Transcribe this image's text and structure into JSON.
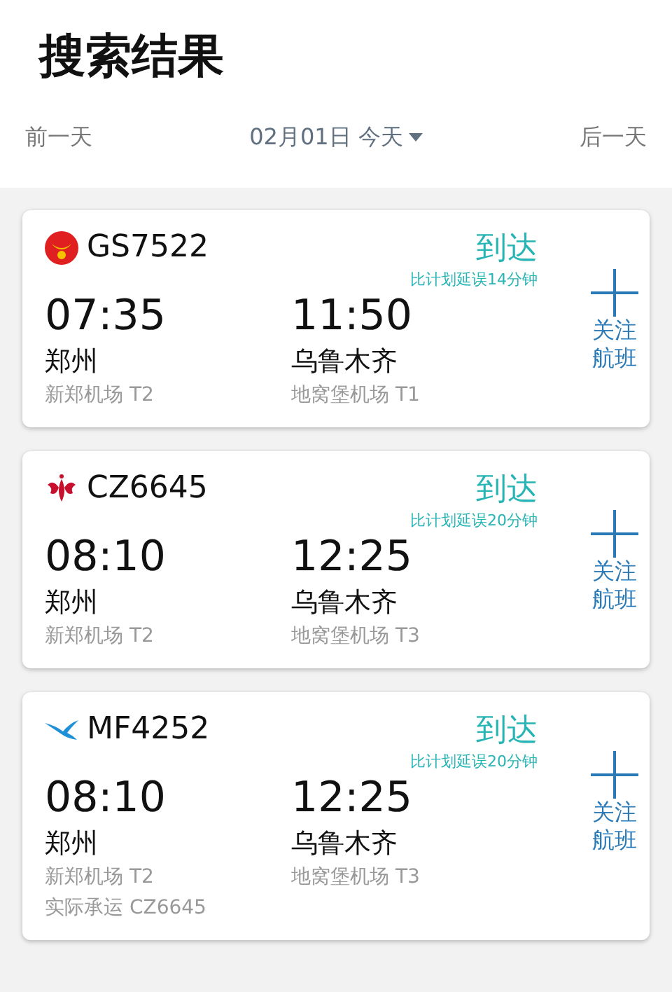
{
  "title": "搜索结果",
  "date_bar": {
    "prev": "前一天",
    "date": "02月01日 今天",
    "next": "后一天"
  },
  "flights": [
    {
      "kind": "round",
      "flight_no": "GS7522",
      "status": "到达",
      "delay": "比计划延误14分钟",
      "dep_time": "07:35",
      "dep_city": "郑州",
      "dep_airport": "新郑机场 T2",
      "arr_time": "11:50",
      "arr_city": "乌鲁木齐",
      "arr_airport": "地窝堡机场 T1",
      "follow": "关注航班"
    },
    {
      "kind": "flower",
      "flight_no": "CZ6645",
      "status": "到达",
      "delay": "比计划延误20分钟",
      "dep_time": "08:10",
      "dep_city": "郑州",
      "dep_airport": "新郑机场 T2",
      "arr_time": "12:25",
      "arr_city": "乌鲁木齐",
      "arr_airport": "地窝堡机场 T3",
      "follow": "关注航班"
    },
    {
      "kind": "bird",
      "flight_no": "MF4252",
      "status": "到达",
      "delay": "比计划延误20分钟",
      "dep_time": "08:10",
      "dep_city": "郑州",
      "dep_airport": "新郑机场 T2",
      "arr_time": "12:25",
      "arr_city": "乌鲁木齐",
      "arr_airport": "地窝堡机场 T3",
      "operated_by": "实际承运 CZ6645",
      "follow": "关注航班"
    }
  ]
}
